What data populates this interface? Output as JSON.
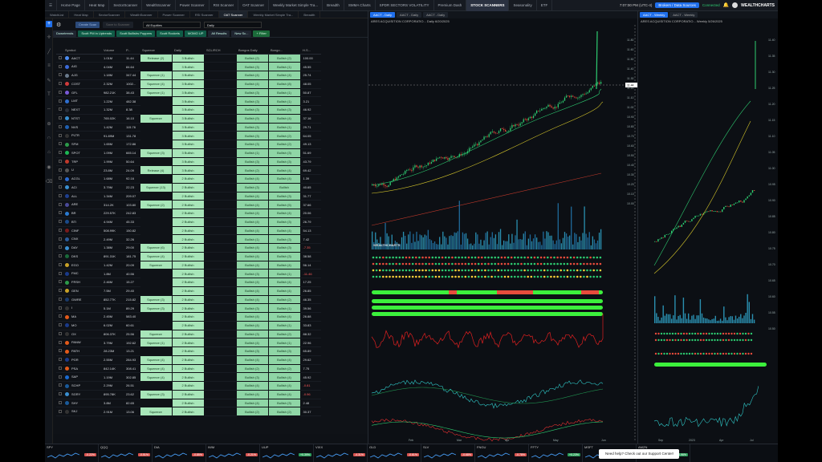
{
  "nav": {
    "items": [
      "Home Page",
      "Heat Map",
      "SectorScanner",
      "WealthScanner",
      "Power Scanner",
      "RSI Scanner",
      "OAT Scanner",
      "Weekly Market Simple Tra...",
      "Breadth",
      "SMMA Charts",
      "SPDR SECTORS VOLATILITY",
      "Premium Dash",
      "STOCK SCANNERS",
      "Seasonality",
      "ETF"
    ],
    "active": "STOCK SCANNERS",
    "time": "7:07:00 PM (UTC-4)",
    "broker_button": "Brokers / Data Sources",
    "status": "Connected",
    "logo": "WEALTHCHARTS"
  },
  "window_tabs": [
    "WatchList",
    "Heat Map",
    "SectorScanner",
    "WealthScanner",
    "Power Scanner",
    "RSI Scanner",
    "OAT Scanner",
    "Weekly Market Simple Tra...",
    "Breadth"
  ],
  "scanner": {
    "create_btn": "Create Scan",
    "disabled_btn": "Save to Scanner",
    "universe": "All Equities",
    "timeframe": "Daily",
    "chips": [
      "Downtrends",
      "Scott PM in Uptrends",
      "Scott Bullishs Poppers",
      "Scott Rockets",
      "MOMO UP",
      "All Results",
      "New Sc..."
    ],
    "add_filter": "+ Filter",
    "columns": [
      "Symbol",
      "Volume",
      "P...",
      "Squeeze",
      "Daily",
      "SCL/RCH",
      "Bongos Daily",
      "Bongo...",
      "H.S..."
    ],
    "footer": "Last Updated: Source 07:05 pm",
    "rows": [
      {
        "sym": "AACT",
        "vol": "1.01M",
        "p": "11.44",
        "sq": "Release (2)",
        "daily": "3 Bullish",
        "b1": "Bullish (2)",
        "b2": "Bullish (2)",
        "hs": "100.00",
        "c": "#4c8cf0"
      },
      {
        "sym": "AIG",
        "vol": "4.04M",
        "p": "84.64",
        "sq": "",
        "daily": "3 Bullish",
        "b1": "Bullish (3)",
        "b2": "Bullish (1)",
        "hs": "45.55",
        "c": "#3b6ad8"
      },
      {
        "sym": "AJG",
        "vol": "1.18M",
        "p": "347.44",
        "sq": "Squeeze (1)",
        "daily": "3 Bullish",
        "b1": "Bullish (4)",
        "b2": "Bullish (4)",
        "hs": "25.74",
        "c": "#6a7a8c"
      },
      {
        "sym": "COST",
        "vol": "2.32M",
        "p": "1002...",
        "sq": "Squeeze (4)",
        "daily": "3 Bullish",
        "b1": "Bullish (4)",
        "b2": "Bullish (8)",
        "hs": "48.05",
        "c": "#d03b3b"
      },
      {
        "sym": "GFL",
        "vol": "982.21K",
        "p": "38.43",
        "sq": "Squeeze (1)",
        "daily": "3 Bullish",
        "b1": "Bullish (3)",
        "b2": "Bullish (1)",
        "hs": "50.87",
        "c": "#7a5ad8"
      },
      {
        "sym": "LMT",
        "vol": "1.22M",
        "p": "482.38",
        "sq": "",
        "daily": "3 Bullish",
        "b1": "Bullish (3)",
        "b2": "Bullish (1)",
        "hs": "3.21",
        "c": "#2f6fd0"
      },
      {
        "sym": "NEXT",
        "vol": "1.32M",
        "p": "8.38",
        "sq": "",
        "daily": "3 Bullish",
        "b1": "Bullish (3)",
        "b2": "Bullish (3)",
        "hs": "46.92",
        "c": "#2a2f39"
      },
      {
        "sym": "NTST",
        "vol": "765.02K",
        "p": "16.10",
        "sq": "Squeeze",
        "daily": "3 Bullish",
        "b1": "Bullish (9)",
        "b2": "Bullish (4)",
        "hs": "37.16",
        "c": "#3a8fd0"
      },
      {
        "sym": "NVS",
        "vol": "1.42M",
        "p": "115.76",
        "sq": "",
        "daily": "3 Bullish",
        "b1": "Bullish (3)",
        "b2": "Bullish (1)",
        "hs": "29.71",
        "c": "#1f5fb0"
      },
      {
        "sym": "PLTR",
        "vol": "91.89M",
        "p": "131.78",
        "sq": "",
        "daily": "3 Bullish",
        "b1": "Bullish (3)",
        "b2": "Bullish (2)",
        "hs": "64.05",
        "c": "#333"
      },
      {
        "sym": "SFM",
        "vol": "1.65M",
        "p": "172.86",
        "sq": "",
        "daily": "3 Bullish",
        "b1": "Bullish (3)",
        "b2": "Bullish (2)",
        "hs": "49.13",
        "c": "#2c9a4a"
      },
      {
        "sym": "SPOT",
        "vol": "1.09M",
        "p": "665.14",
        "sq": "Squeeze (3)",
        "daily": "3 Bullish",
        "b1": "Bullish (1)",
        "b2": "Bullish (3)",
        "hs": "51.69",
        "c": "#1db954"
      },
      {
        "sym": "TRP",
        "vol": "1.99M",
        "p": "50.64",
        "sq": "",
        "daily": "3 Bullish",
        "b1": "Bullish (3)",
        "b2": "Bullish (3)",
        "hs": "43.79",
        "c": "#c0392b"
      },
      {
        "sym": "U",
        "vol": "23.8M",
        "p": "24.09",
        "sq": "Release (4)",
        "daily": "3 Bullish",
        "b1": "Bullish (2)",
        "b2": "Bullish (4)",
        "hs": "69.42",
        "c": "#555"
      },
      {
        "sym": "ACGL",
        "vol": "1.68M",
        "p": "92.16",
        "sq": "",
        "daily": "2 Bullish",
        "b1": "Bullish (4)",
        "b2": "Bullish (4)",
        "hs": "1.39",
        "c": "#2a6ad0"
      },
      {
        "sym": "ACI",
        "vol": "3.79M",
        "p": "22.23",
        "sq": "Squeeze (13)",
        "daily": "2 Bullish",
        "b1": "Bullish (3)",
        "b2": "Bullish",
        "hs": "40.65",
        "c": "#3a8fd0"
      },
      {
        "sym": "ALL",
        "vol": "1.34M",
        "p": "209.07",
        "sq": "",
        "daily": "2 Bullish",
        "b1": "Bullish (4)",
        "b2": "Bullish (3)",
        "hs": "31.77",
        "c": "#1f3f8f"
      },
      {
        "sym": "ARE",
        "vol": "314.2K",
        "p": "103.80",
        "sq": "Squeeze (2)",
        "daily": "2 Bullish",
        "b1": "Bullish (4)",
        "b2": "Bullish (5)",
        "hs": "37.66",
        "c": "#4a4a9a"
      },
      {
        "sym": "BR",
        "vol": "229.57K",
        "p": "242.83",
        "sq": "",
        "daily": "2 Bullish",
        "b1": "Bullish (4)",
        "b2": "Bullish (4)",
        "hs": "20.06",
        "c": "#2a7ad0"
      },
      {
        "sym": "BTI",
        "vol": "4.94M",
        "p": "45.33",
        "sq": "",
        "daily": "2 Bullish",
        "b1": "Bullish (4)",
        "b2": "Bullish (3)",
        "hs": "26.79",
        "c": "#1a4a8a"
      },
      {
        "sym": "CINF",
        "vol": "508.99K",
        "p": "150.82",
        "sq": "",
        "daily": "2 Bullish",
        "b1": "Bullish (4)",
        "b2": "Bullish (4)",
        "hs": "54.13",
        "c": "#7a1a1a"
      },
      {
        "sym": "CNX",
        "vol": "2.49M",
        "p": "32.26",
        "sq": "",
        "daily": "2 Bullish",
        "b1": "Bullish (1)",
        "b2": "Bullish (3)",
        "hs": "7.42",
        "c": "#2a5a9a"
      },
      {
        "sym": "DAY",
        "vol": "1.38M",
        "p": "29.00",
        "sq": "Squeeze (6)",
        "daily": "2 Bullish",
        "b1": "Bullish (4)",
        "b2": "Bullish (3)",
        "hs": "-7.35",
        "c": "#3a8fd0"
      },
      {
        "sym": "DKS",
        "vol": "891.31K",
        "p": "181.75",
        "sq": "Squeeze (4)",
        "daily": "2 Bullish",
        "b1": "Bullish (4)",
        "b2": "Bullish (3)",
        "hs": "38.58",
        "c": "#1a6a3a"
      },
      {
        "sym": "EGO",
        "vol": "1.42M",
        "p": "20.09",
        "sq": "Squeeze",
        "daily": "2 Bullish",
        "b1": "Bullish (4)",
        "b2": "Bullish (4)",
        "hs": "56.14",
        "c": "#c9a227"
      },
      {
        "sym": "FMC",
        "vol": "1.8M",
        "p": "40.56",
        "sq": "",
        "daily": "2 Bullish",
        "b1": "Bullish (3)",
        "b2": "Bullish (1)",
        "hs": "-11.46",
        "c": "#1a3a8a"
      },
      {
        "sym": "FRSH",
        "vol": "2.46M",
        "p": "15.27",
        "sq": "",
        "daily": "2 Bullish",
        "b1": "Bullish (4)",
        "b2": "Bullish (4)",
        "hs": "17.25",
        "c": "#2c9a4a"
      },
      {
        "sym": "GEN",
        "vol": "7.5M",
        "p": "29.40",
        "sq": "",
        "daily": "2 Bullish",
        "b1": "Bullish (4)",
        "b2": "Bullish (4)",
        "hs": "26.85",
        "c": "#c9a227"
      },
      {
        "sym": "GWRE",
        "vol": "852.77K",
        "p": "215.82",
        "sq": "Squeeze (3)",
        "daily": "2 Bullish",
        "b1": "Bullish (4)",
        "b2": "Bullish (2)",
        "hs": "46.35",
        "c": "#1a3a6a"
      },
      {
        "sym": "I",
        "vol": "5.1M",
        "p": "89.29",
        "sq": "Squeeze (3)",
        "daily": "2 Bullish",
        "b1": "Bullish (3)",
        "b2": "Bullish (1)",
        "hs": "39.56",
        "c": "#333"
      },
      {
        "sym": "MA",
        "vol": "2.45M",
        "p": "583.40",
        "sq": "",
        "daily": "2 Bullish",
        "b1": "Bullish (4)",
        "b2": "Bullish (4)",
        "hs": "26.88",
        "c": "#e35a1a"
      },
      {
        "sym": "MO",
        "vol": "6.02M",
        "p": "60.61",
        "sq": "",
        "daily": "2 Bullish",
        "b1": "Bullish (4)",
        "b2": "Bullish (1)",
        "hs": "33.83",
        "c": "#1a3a8a"
      },
      {
        "sym": "OX",
        "vol": "806.37K",
        "p": "25.56",
        "sq": "Squeeze",
        "daily": "2 Bullish",
        "b1": "Bullish (3)",
        "b2": "Bullish (2)",
        "hs": "88.32",
        "c": "#333"
      },
      {
        "sym": "PANW",
        "vol": "3.79M",
        "p": "192.62",
        "sq": "Squeeze (1)",
        "daily": "2 Bullish",
        "b1": "Bullish (4)",
        "b2": "Bullish (1)",
        "hs": "22.96",
        "c": "#e35a1a"
      },
      {
        "sym": "PATH",
        "vol": "28.23M",
        "p": "13.21",
        "sq": "",
        "daily": "2 Bullish",
        "b1": "Bullish (3)",
        "b2": "Bullish (3)",
        "hs": "65.89",
        "c": "#e35a1a"
      },
      {
        "sym": "PGR",
        "vol": "2.55M",
        "p": "284.93",
        "sq": "Squeeze (4)",
        "daily": "2 Bullish",
        "b1": "Bullish (4)",
        "b2": "Bullish (4)",
        "hs": "29.62",
        "c": "#1a3a8a"
      },
      {
        "sym": "PSA",
        "vol": "842.14K",
        "p": "308.41",
        "sq": "Squeeze (4)",
        "daily": "2 Bullish",
        "b1": "Bullish (2)",
        "b2": "Bullish (2)",
        "hs": "7.75",
        "c": "#e35a1a"
      },
      {
        "sym": "SAP",
        "vol": "1.19M",
        "p": "302.85",
        "sq": "Squeeze (4)",
        "daily": "2 Bullish",
        "b1": "Bullish (3)",
        "b2": "Bullish (4)",
        "hs": "45.92",
        "c": "#1a6ad0"
      },
      {
        "sym": "SCHP",
        "vol": "2.29M",
        "p": "26.51",
        "sq": "",
        "daily": "2 Bullish",
        "b1": "Bullish (4)",
        "b2": "Bullish (4)",
        "hs": "-0.81",
        "c": "#1a5a9a"
      },
      {
        "sym": "SGRY",
        "vol": "895.78K",
        "p": "23.62",
        "sq": "Squeeze (3)",
        "daily": "2 Bullish",
        "b1": "Bullish (4)",
        "b2": "Bullish (4)",
        "hs": "-0.96",
        "c": "#3a8fd0"
      },
      {
        "sym": "SHY",
        "vol": "3.8M",
        "p": "82.65",
        "sq": "",
        "daily": "2 Bullish",
        "b1": "Bullish (4)",
        "b2": "Bullish (3)",
        "hs": "2.48",
        "c": "#1a5a9a"
      },
      {
        "sym": "SKJ",
        "vol": "2.91M",
        "p": "13.06",
        "sq": "Squeeze",
        "daily": "2 Bullish",
        "b1": "Bullish (2)",
        "b2": "Bullish (2)",
        "hs": "30.37",
        "c": "#333"
      }
    ]
  },
  "chart_daily": {
    "tabs": [
      "AACT - Daily",
      "AACT - Daily",
      "AACT - Daily"
    ],
    "title": "ARES ACQUISITION CORPORATIO...  Daily  6/20/2025",
    "months": [
      "Feb",
      "Mar",
      "Apr",
      "May",
      "Jun"
    ],
    "price_labels": [
      "11.80",
      "11.60",
      "11.50",
      "11.40",
      "11.30",
      "11.20",
      "11.10",
      "11.00",
      "10.90",
      "10.80",
      "10.70",
      "10.60",
      "10.50",
      "10.40",
      "10.30",
      "10.20",
      "10.10",
      "10.00"
    ],
    "last_price": "11.44",
    "watermark": "WEALTHCHARTS"
  },
  "chart_weekly": {
    "tabs": [
      "AACT - Weekly",
      "AACT - Weekly"
    ],
    "title": "ARES ACQUISITION CORPORATIO...  Weekly  5/26/2025",
    "years": [
      "Sep",
      "2023",
      "Apr",
      "Jul"
    ],
    "price_labels": [
      "11.40",
      "11.35",
      "11.30",
      "11.25",
      "11.20",
      "11.15",
      "11.10",
      "11.05",
      "11.00",
      "10.95",
      "10.90",
      "10.85",
      "10.80",
      "10.75",
      "10.70",
      "10.65",
      "10.60",
      "10.55",
      "10.50"
    ]
  },
  "tickers": [
    {
      "sym": "SPY",
      "chg": "-0.22%",
      "col": "#d9534f"
    },
    {
      "sym": "QQQ",
      "chg": "-0.51%",
      "col": "#d9534f"
    },
    {
      "sym": "DIA",
      "chg": "-0.85%",
      "col": "#d9534f"
    },
    {
      "sym": "IWM",
      "chg": "-0.21%",
      "col": "#d9534f"
    },
    {
      "sym": "UUP",
      "chg": "+0.39%",
      "col": "#2e9e5b"
    },
    {
      "sym": "VIXX",
      "chg": "-4.31%",
      "col": "#d9534f"
    },
    {
      "sym": "GLD",
      "chg": "-0.61%",
      "col": "#d9534f"
    },
    {
      "sym": "SLV",
      "chg": "-0.68%",
      "col": "#d9534f"
    },
    {
      "sym": "FNGU",
      "chg": "-0.78%",
      "col": "#d9534f"
    },
    {
      "sym": "FFTY",
      "chg": "+0.23%",
      "col": "#2e9e5b"
    },
    {
      "sym": "MSFT",
      "chg": "-0.59%",
      "col": "#d9534f"
    },
    {
      "sym": "AMZN",
      "chg": "+0.96%",
      "col": "#2e9e5b"
    }
  ],
  "help": "Need help? Check out our Support Center!"
}
